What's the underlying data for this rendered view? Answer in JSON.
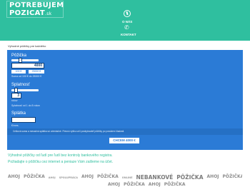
{
  "header": {
    "logo": {
      "line1": "POTREBUJEM",
      "line2": "POZICAT",
      "suffix": ".sk"
    },
    "nav": [
      {
        "label": "O NÁS",
        "icon": "info-icon"
      },
      {
        "label": "KONTAKT",
        "icon": "phone-icon"
      }
    ],
    "background_color": "#2fbf9f"
  },
  "subtitle": "Výhodné pôžičky pre každého",
  "calculator": {
    "background_color": "#2b7bd6",
    "loan": {
      "label": "Pôžička",
      "value": "4000",
      "range_note": "Suma od 100 € do 25000 €",
      "pill_left": "100 €",
      "pill_right": "25000 €"
    },
    "repayment": {
      "label": "Splatnosť",
      "value": "3",
      "unit": "rokov",
      "range_note": "Splatnosť od 1 do 8 rokov"
    },
    "installment": {
      "label": "Splátka",
      "unit": "€/mes."
    },
    "info_text": "Celková suma a mesačná splátka sú orientačné. Presnú výšku určí poskytovateľ pôžičky po posúdení žiadosti.",
    "apply_label": "CHCEM 4000 €"
  },
  "tagline": {
    "line1": "Výhodné pôžičky od ľudí pre ľudí bez kontroly bankového registra.",
    "line2": "Požiadajte o pôžičku cez internet a peniaze Vám zašleme na účet."
  },
  "banner": {
    "row1": [
      "AHOJ",
      "PÔŽIČKA",
      "AHOJ",
      "SPOLUPRÁCA",
      "AHOJ",
      "PÔŽIČKA",
      "ONLINE",
      "NEBANKOVÉ",
      "PÔŽIČKA",
      "AHOJ",
      "PÔŽIČKA"
    ],
    "row2": [
      "AHOJ",
      "PÔŽIČKA",
      "AHOJ",
      "PÔŽIČKA"
    ]
  }
}
